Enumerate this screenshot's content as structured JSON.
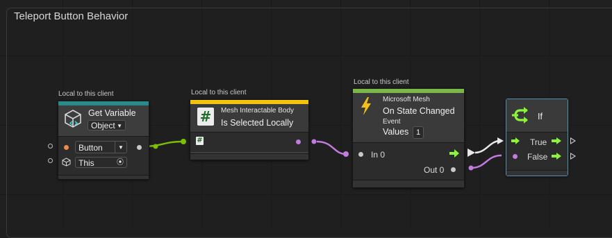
{
  "group": {
    "title": "Teleport Button Behavior"
  },
  "nodes": {
    "get_variable": {
      "caption": "Local to this client",
      "title": "Get Variable",
      "type_value": "Object",
      "inputs": [
        {
          "value": "Button"
        },
        {
          "value": "This"
        }
      ],
      "accent": "#2a8a8a"
    },
    "mesh_interactable": {
      "caption": "Local to this client",
      "subtitle": "Mesh Interactable Body",
      "title": "Is Selected Locally",
      "icon_glyph": "#",
      "accent": "#f2c40f"
    },
    "state_changed": {
      "caption": "Local to this client",
      "subtitle": "Microsoft Mesh",
      "title": "On State Changed",
      "kind": "Event",
      "values_label": "Values",
      "values_count": "1",
      "port_in": "In 0",
      "port_out": "Out 0",
      "accent": "#7ab648"
    },
    "if_node": {
      "title": "If",
      "true_label": "True",
      "false_label": "False"
    }
  },
  "colors": {
    "wire_object": "#7ac000",
    "wire_bool": "#c37be0",
    "wire_flow": "#e8e8e8",
    "flow_arrow": "#8cf53a"
  }
}
